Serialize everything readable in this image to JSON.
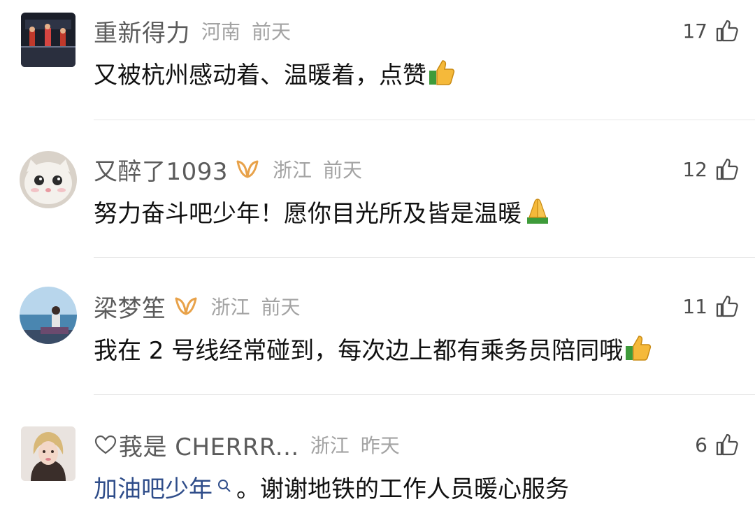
{
  "comments": [
    {
      "username": "重新得力",
      "location": "河南",
      "time": "前天",
      "likes": "17",
      "text": "又被杭州感动着、温暖着，点赞",
      "emoji": "thumbs-up-emoji",
      "avatar": "video-thumbnail-avatar"
    },
    {
      "username": "又醉了1093",
      "location": "浙江",
      "time": "前天",
      "likes": "12",
      "text": "努力奋斗吧少年！愿你目光所及皆是温暖",
      "emoji": "praying-hands-emoji",
      "badge": "vip-badge-icon",
      "avatar": "white-cat-avatar"
    },
    {
      "username": "梁梦笙",
      "location": "浙江",
      "time": "前天",
      "likes": "11",
      "text": "我在 2 号线经常碰到，每次边上都有乘务员陪同哦",
      "emoji": "thumbs-up-emoji",
      "badge": "vip-badge-icon",
      "avatar": "seaside-avatar"
    },
    {
      "username": "莪是 CHERRR...",
      "location": "浙江",
      "time": "昨天",
      "likes": "6",
      "topic": "加油吧少年",
      "text": "。谢谢地铁的工作人员暖心服务",
      "prefix_icon": "heart-outline-icon",
      "avatar": "portrait-avatar"
    }
  ],
  "colors": {
    "username": "#5b5b5b",
    "meta": "#a3a3a3",
    "topic_link": "#2f4d8a",
    "badge": "#e8a24a",
    "divider": "#e6e6e6"
  }
}
